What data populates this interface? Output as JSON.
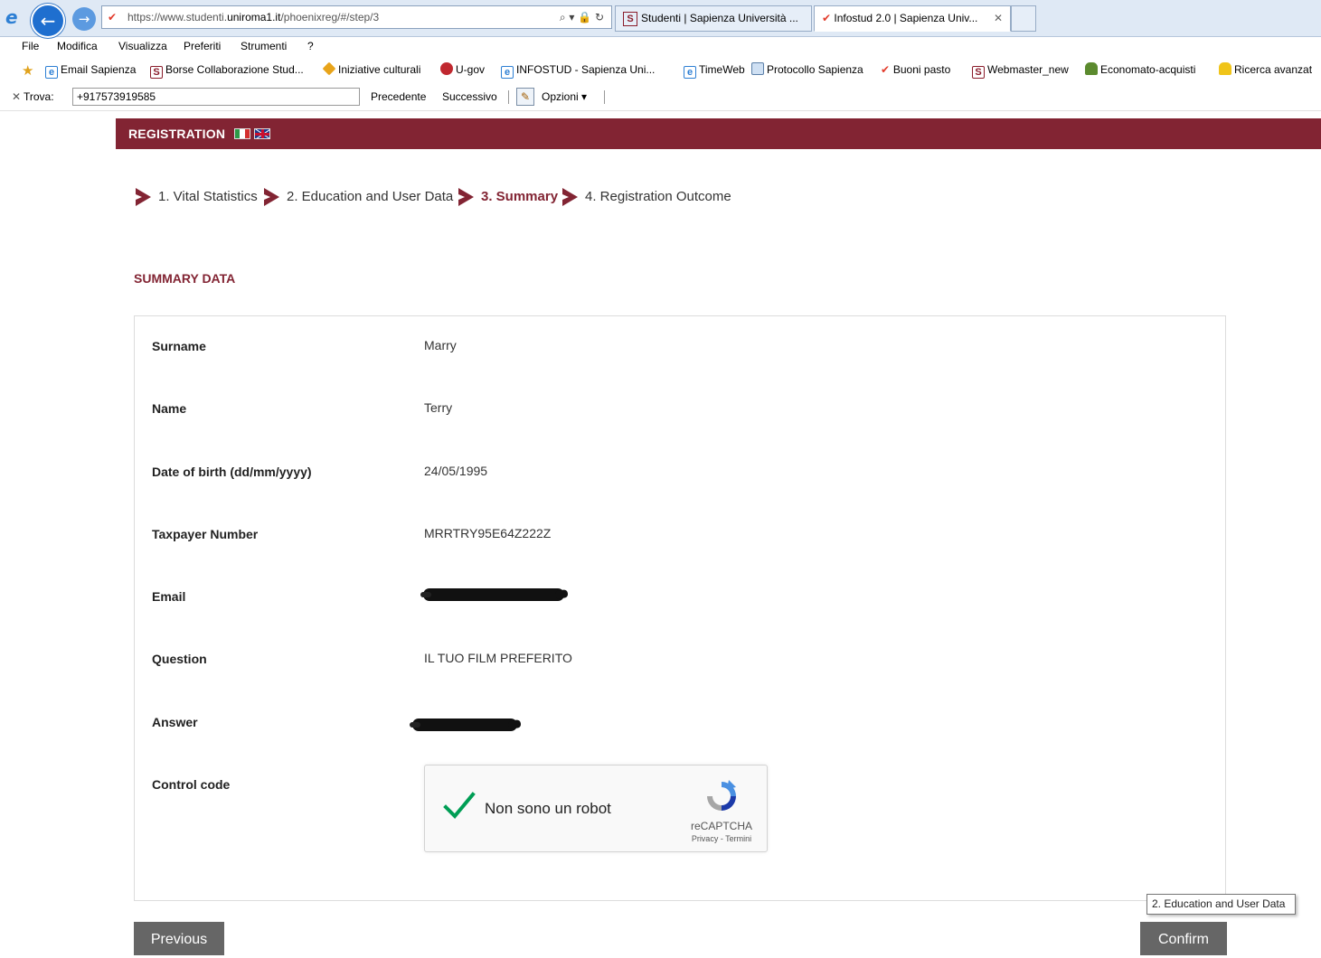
{
  "browser": {
    "address": {
      "scheme_host_prefix": "https://www.studenti.",
      "host_bold": "uniroma1.it",
      "path": "/phoenixreg/#/step/3",
      "icons": "⌕ ▾ 🔒 ↻"
    },
    "tabs": [
      {
        "label": "Studenti | Sapienza Università ..."
      },
      {
        "label": "Infostud 2.0 | Sapienza Univ..."
      }
    ],
    "menu": [
      "File",
      "Modifica",
      "Visualizza",
      "Preferiti",
      "Strumenti",
      "?"
    ],
    "favorites": [
      {
        "label": "Email Sapienza",
        "icon": "ie-page-icon"
      },
      {
        "label": "Borse Collaborazione Stud...",
        "icon": "sapienza-s-icon"
      },
      {
        "label": "Iniziative culturali",
        "icon": "diamond-icon"
      },
      {
        "label": "U-gov",
        "icon": "ugov-icon"
      },
      {
        "label": "INFOSTUD - Sapienza Uni...",
        "icon": "ie-page-icon"
      },
      {
        "label": "TimeWeb",
        "icon": "ie-page-icon"
      },
      {
        "label": "Protocollo Sapienza",
        "icon": "protocol-icon"
      },
      {
        "label": "Buoni pasto",
        "icon": "bird-icon"
      },
      {
        "label": "Webmaster_new",
        "icon": "sapienza-s-icon"
      },
      {
        "label": "Economato-acquisti",
        "icon": "people-icon"
      },
      {
        "label": "Ricerca avanzat",
        "icon": "people-yellow-icon"
      }
    ],
    "find": {
      "label": "Trova:",
      "value": "+917573919585",
      "previous": "Precedente",
      "next": "Successivo",
      "options": "Opzioni ▾"
    }
  },
  "page": {
    "header_title": "REGISTRATION",
    "steps": [
      {
        "label": "1. Vital Statistics",
        "active": false
      },
      {
        "label": "2. Education and User Data",
        "active": false
      },
      {
        "label": "3. Summary",
        "active": true
      },
      {
        "label": "4. Registration Outcome",
        "active": false
      }
    ],
    "section_title": "SUMMARY DATA",
    "fields": [
      {
        "label": "Surname",
        "value": "Marry"
      },
      {
        "label": "Name",
        "value": "Terry"
      },
      {
        "label": "Date of birth (dd/mm/yyyy)",
        "value": "24/05/1995"
      },
      {
        "label": "Taxpayer Number",
        "value": "MRRTRY95E64Z222Z"
      },
      {
        "label": "Email",
        "value": ""
      },
      {
        "label": "Question",
        "value": "IL TUO FILM PREFERITO"
      },
      {
        "label": "Answer",
        "value": ""
      }
    ],
    "control_code_label": "Control code",
    "captcha": {
      "text": "Non sono un robot",
      "brand": "reCAPTCHA",
      "links": "Privacy - Termini",
      "checked": true
    },
    "previous_button": "Previous",
    "confirm_button": "Confirm",
    "tooltip": "2. Education and User Data"
  },
  "colors": {
    "brand": "#822433",
    "button": "#666666",
    "captcha_check": "#009e55"
  }
}
